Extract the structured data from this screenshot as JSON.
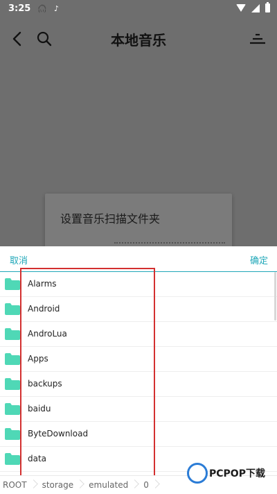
{
  "status_bar": {
    "time": "3:25",
    "icons": [
      "headset-icon",
      "tiktok-icon",
      "wifi-icon",
      "signal-icon",
      "battery-icon"
    ]
  },
  "header": {
    "title": "本地音乐",
    "icons": [
      "back-icon",
      "search-icon",
      "sort-icon"
    ]
  },
  "background_dialog": {
    "title": "设置音乐扫描文件夹"
  },
  "sheet": {
    "cancel_label": "取消",
    "confirm_label": "确定",
    "folders": [
      "Alarms",
      "Android",
      "AndroLua",
      "Apps",
      "backups",
      "baidu",
      "ByteDownload",
      "data"
    ]
  },
  "breadcrumb": [
    "ROOT",
    "storage",
    "emulated",
    "0"
  ],
  "watermark": {
    "brand": "PCPOP下载"
  },
  "colors": {
    "accent": "#1fa7b8",
    "folder": "#4fd8b6",
    "highlight": "#d32f2f",
    "overlay": "#6e6e6e"
  }
}
